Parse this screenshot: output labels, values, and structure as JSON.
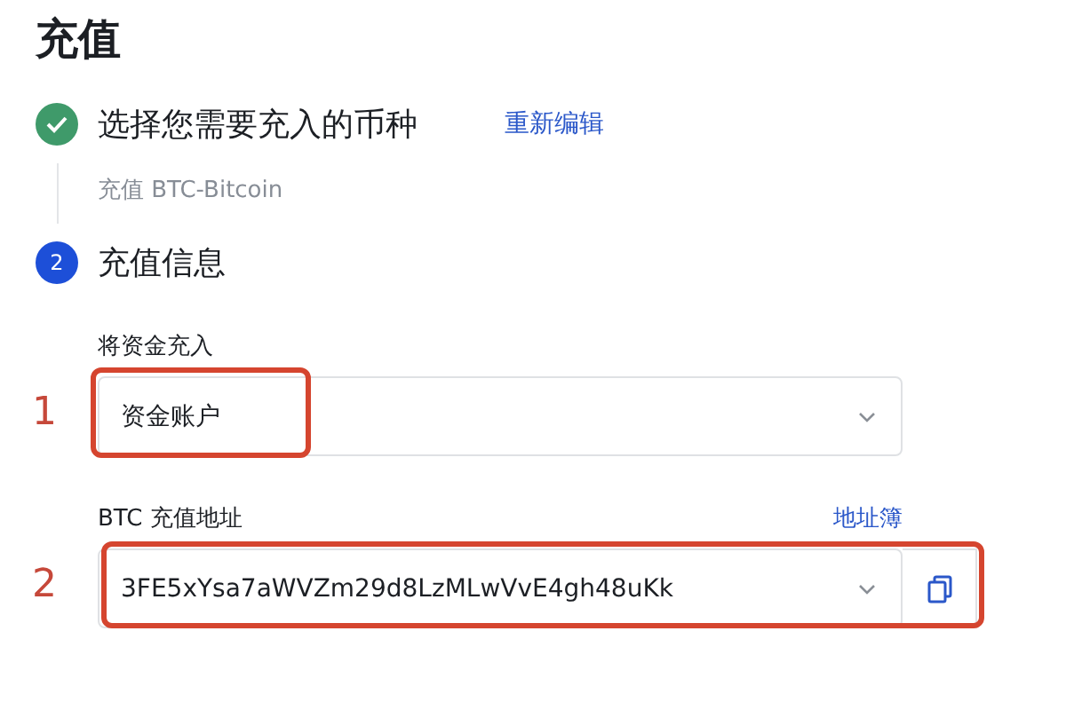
{
  "title": "充值",
  "steps": [
    {
      "completed": true,
      "label": "选择您需要充入的币种",
      "action": "重新编辑",
      "summary": "充值 BTC-Bitcoin"
    },
    {
      "completed": false,
      "number": "2",
      "label": "充值信息"
    }
  ],
  "fields": [
    {
      "kind": "select",
      "label": "将资金充入",
      "value": "资金账户",
      "annotation": "1",
      "highlighted": true
    },
    {
      "kind": "address",
      "label": "BTC 充值地址",
      "link": "地址簿",
      "value": "3FE5xYsa7aWVZm29d8LzMLwVvE4gh48uKk",
      "annotation": "2",
      "highlighted": true
    }
  ]
}
